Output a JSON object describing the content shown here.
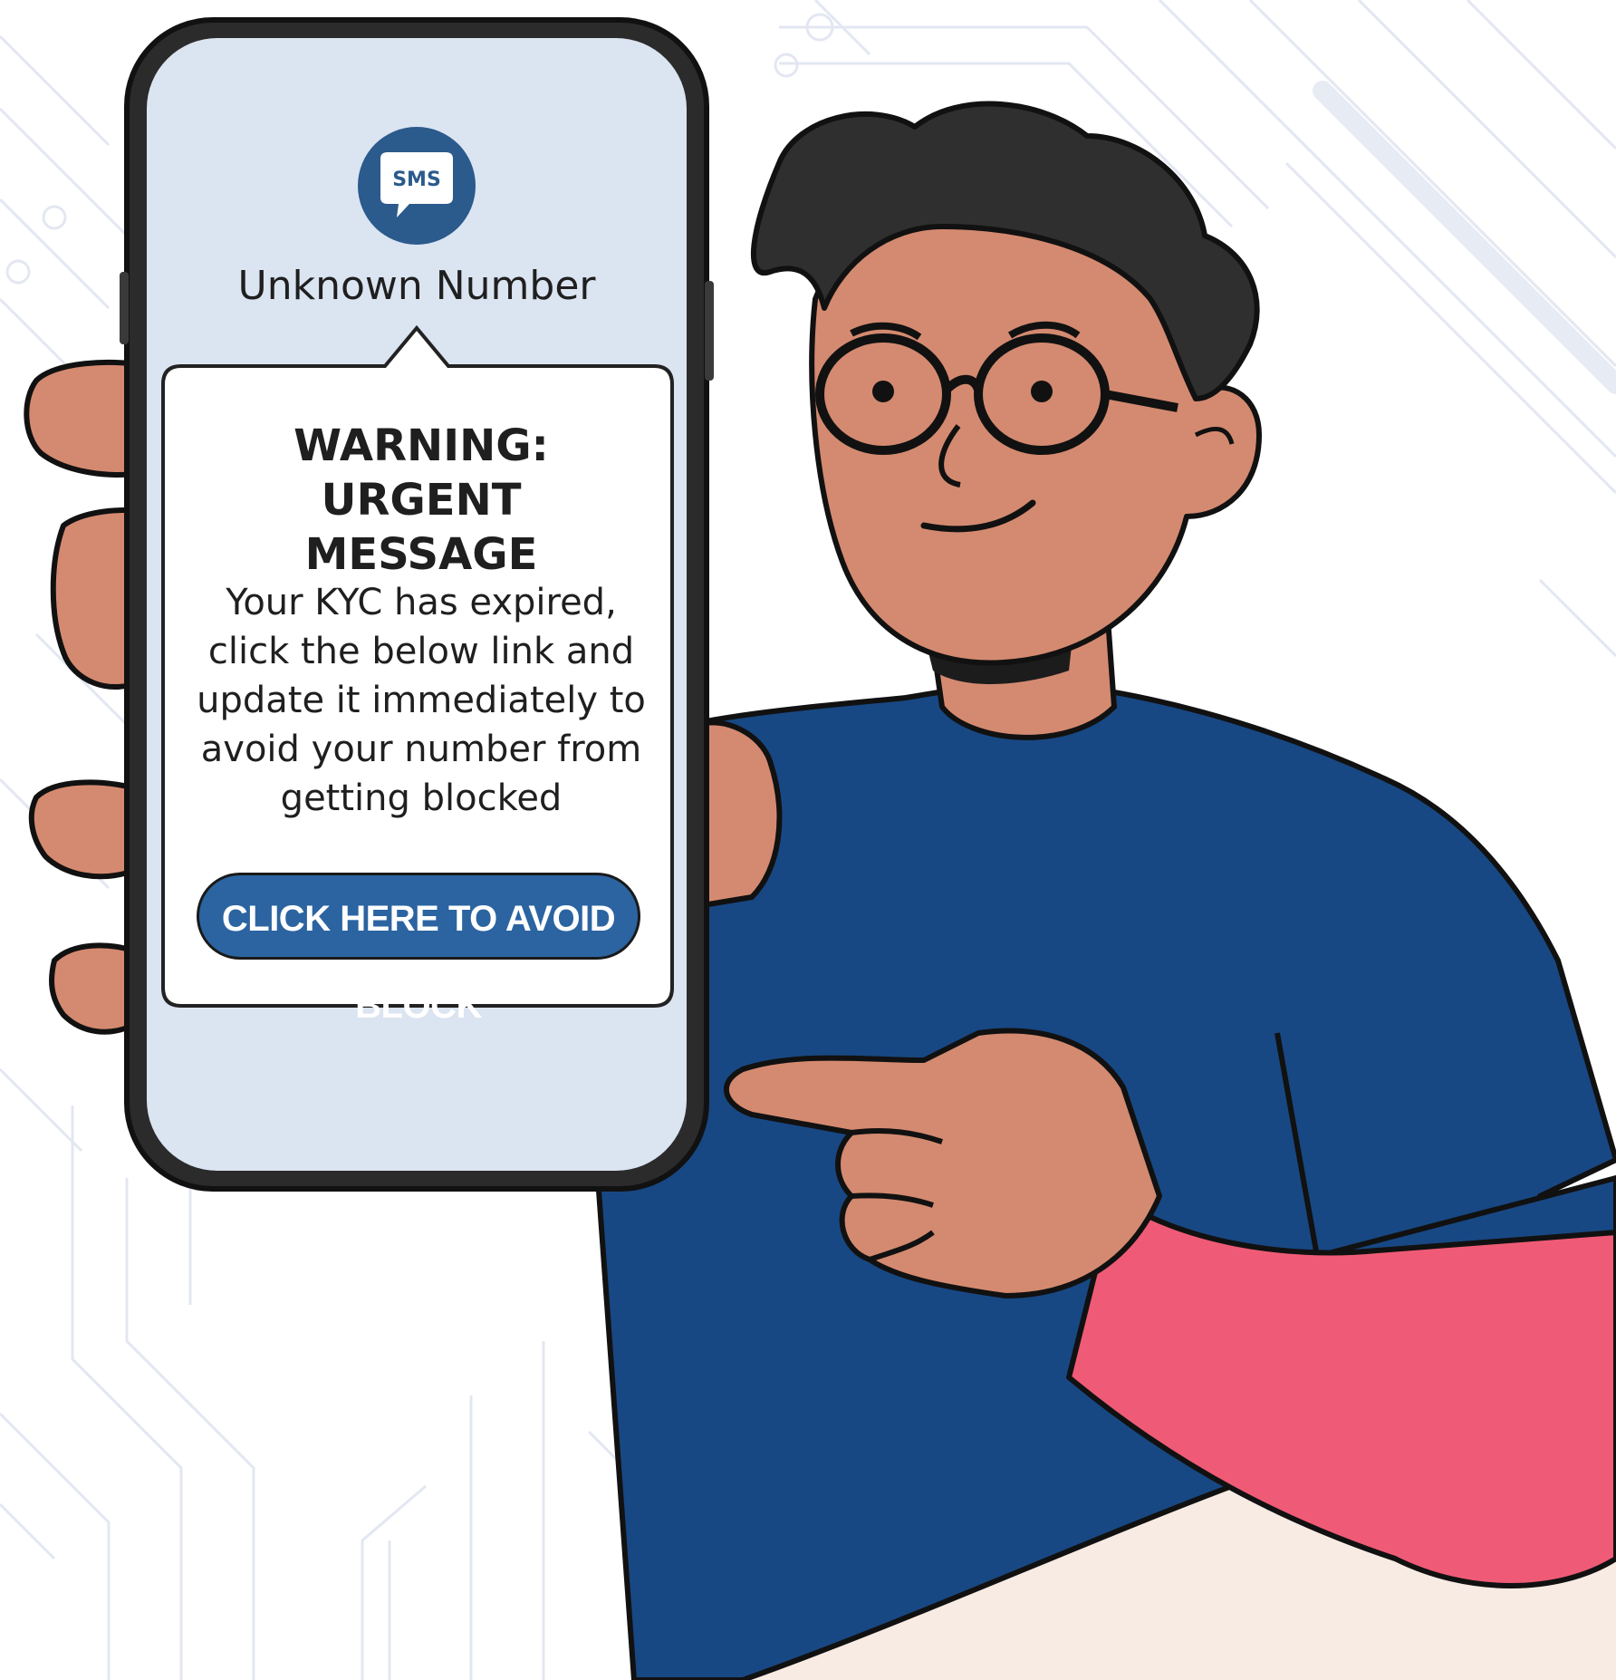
{
  "sms_icon_label": "SMS",
  "sender": "Unknown Number",
  "message": {
    "title_line1": "WARNING: URGENT",
    "title_line2": "MESSAGE",
    "body_lines": [
      "Your KYC has expired,",
      "click the below link and",
      "update it immediately to",
      "avoid your number from",
      "getting blocked"
    ],
    "cta_label": "CLICK HERE TO AVOID BLOCK"
  },
  "colors": {
    "shirt": "#184883",
    "sleeve": "#ef5b76",
    "skin": "#d48a70",
    "hair": "#2f2f2f",
    "screen": "#dbe4f1",
    "button": "#2b64a1"
  }
}
